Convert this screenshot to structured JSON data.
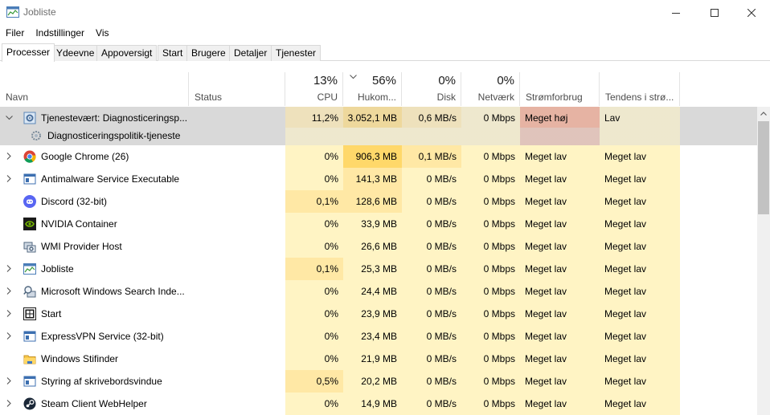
{
  "window": {
    "title": "Jobliste"
  },
  "menu": [
    "Filer",
    "Indstillinger",
    "Vis"
  ],
  "tabs": [
    "Processer",
    "Ydeevne",
    "Appoversigt",
    "Start",
    "Brugere",
    "Detaljer",
    "Tjenester"
  ],
  "header": {
    "name": "Navn",
    "status": "Status",
    "cpu_pct": "13%",
    "cpu": "CPU",
    "mem_pct": "56%",
    "mem": "Hukom...",
    "disk_pct": "0%",
    "disk": "Disk",
    "net_pct": "0%",
    "net": "Netværk",
    "power": "Strømforbrug",
    "trend": "Tendens i strø..."
  },
  "colors": {
    "selected_row": "#d9d9d9",
    "heat_light": "#fff4c4",
    "heat_mid": "#ffe8a5",
    "heat_strong": "#ffd86a",
    "power_high": "#e6b3a3"
  },
  "rows": [
    {
      "name": "Tjenestevært: Diagnosticeringsp...",
      "status": "",
      "cpu": "11,2%",
      "mem": "3.052,1 MB",
      "disk": "0,6 MB/s",
      "net": "0 Mbps",
      "power": "Meget høj",
      "trend": "Lav",
      "icon": "gear-icon",
      "expanded": true,
      "selected": true
    },
    {
      "name": "Diagnosticeringspolitik-tjeneste",
      "child": true,
      "icon": "service-gear-icon",
      "selected": true
    },
    {
      "name": "Google Chrome (26)",
      "status": "",
      "cpu": "0%",
      "mem": "906,3 MB",
      "disk": "0,1 MB/s",
      "net": "0 Mbps",
      "power": "Meget lav",
      "trend": "Meget lav",
      "icon": "chrome-icon",
      "expandable": true
    },
    {
      "name": "Antimalware Service Executable",
      "status": "",
      "cpu": "0%",
      "mem": "141,3 MB",
      "disk": "0 MB/s",
      "net": "0 Mbps",
      "power": "Meget lav",
      "trend": "Meget lav",
      "icon": "app-window-icon",
      "expandable": true
    },
    {
      "name": "Discord (32-bit)",
      "status": "",
      "cpu": "0,1%",
      "mem": "128,6 MB",
      "disk": "0 MB/s",
      "net": "0 Mbps",
      "power": "Meget lav",
      "trend": "Meget lav",
      "icon": "discord-icon"
    },
    {
      "name": "NVIDIA Container",
      "status": "",
      "cpu": "0%",
      "mem": "33,9 MB",
      "disk": "0 MB/s",
      "net": "0 Mbps",
      "power": "Meget lav",
      "trend": "Meget lav",
      "icon": "nvidia-icon"
    },
    {
      "name": "WMI Provider Host",
      "status": "",
      "cpu": "0%",
      "mem": "26,6 MB",
      "disk": "0 MB/s",
      "net": "0 Mbps",
      "power": "Meget lav",
      "trend": "Meget lav",
      "icon": "wmi-icon"
    },
    {
      "name": "Jobliste",
      "status": "",
      "cpu": "0,1%",
      "mem": "25,3 MB",
      "disk": "0 MB/s",
      "net": "0 Mbps",
      "power": "Meget lav",
      "trend": "Meget lav",
      "icon": "task-manager-icon",
      "expandable": true
    },
    {
      "name": "Microsoft Windows Search Inde...",
      "status": "",
      "cpu": "0%",
      "mem": "24,4 MB",
      "disk": "0 MB/s",
      "net": "0 Mbps",
      "power": "Meget lav",
      "trend": "Meget lav",
      "icon": "search-indexer-icon",
      "expandable": true
    },
    {
      "name": "Start",
      "status": "",
      "cpu": "0%",
      "mem": "23,9 MB",
      "disk": "0 MB/s",
      "net": "0 Mbps",
      "power": "Meget lav",
      "trend": "Meget lav",
      "icon": "start-icon",
      "expandable": true
    },
    {
      "name": "ExpressVPN Service (32-bit)",
      "status": "",
      "cpu": "0%",
      "mem": "23,4 MB",
      "disk": "0 MB/s",
      "net": "0 Mbps",
      "power": "Meget lav",
      "trend": "Meget lav",
      "icon": "app-window-icon",
      "expandable": true
    },
    {
      "name": "Windows Stifinder",
      "status": "",
      "cpu": "0%",
      "mem": "21,9 MB",
      "disk": "0 MB/s",
      "net": "0 Mbps",
      "power": "Meget lav",
      "trend": "Meget lav",
      "icon": "folder-icon"
    },
    {
      "name": "Styring af skrivebordsvindue",
      "status": "",
      "cpu": "0,5%",
      "mem": "20,2 MB",
      "disk": "0 MB/s",
      "net": "0 Mbps",
      "power": "Meget lav",
      "trend": "Meget lav",
      "icon": "app-window-icon",
      "expandable": true
    },
    {
      "name": "Steam Client WebHelper",
      "status": "",
      "cpu": "0%",
      "mem": "14,9 MB",
      "disk": "0 MB/s",
      "net": "0 Mbps",
      "power": "Meget lav",
      "trend": "Meget lav",
      "icon": "steam-icon",
      "expandable": true
    }
  ]
}
